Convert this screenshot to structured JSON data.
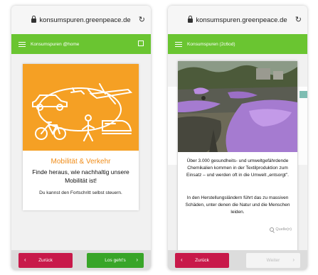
{
  "left": {
    "url": "konsumspuren.greenpeace.de",
    "app_title": "Konsumspuren @home",
    "card_title": "Mobilität & Verkehr",
    "card_subtitle": "Finde heraus, wie nachhaltig unsere Mobilität ist!",
    "card_note": "Du kannst den Fortschritt selbst steuern.",
    "back_label": "Zurück",
    "go_label": "Los geht's",
    "arrow_left": "‹",
    "arrow_right": "›"
  },
  "right": {
    "url": "konsumspuren.greenpeace.de",
    "app_title": "Konsumspuren (2c6od)",
    "paragraph1": "Über 3.000 gesundheits- und umweltgefährdende Chemikalien kommen in der Textilproduktion zum Einsatz – und werden oft in die Umwelt „entsorgt\".",
    "paragraph2": "In den Herstellungsländern führt das zu massiven Schäden, unter denen die Natur und die Menschen leiden.",
    "source_label": "Quelle(n)",
    "back_label": "Zurück",
    "next_label": "Weiter",
    "arrow_left": "‹",
    "arrow_right": "›"
  },
  "icons": {
    "reload": "reload-icon",
    "lock": "lock-icon",
    "menu": "hamburger-menu-icon",
    "fullscreen": "fullscreen-icon",
    "search": "magnifier-icon"
  },
  "colors": {
    "brand_green": "#6ac531",
    "go_green": "#38a528",
    "back_red": "#c8194a",
    "illustration_orange": "#f5a024",
    "title_orange": "#f08c19",
    "foam_purple": "#a57bd0"
  },
  "reload_glyph": "↻"
}
